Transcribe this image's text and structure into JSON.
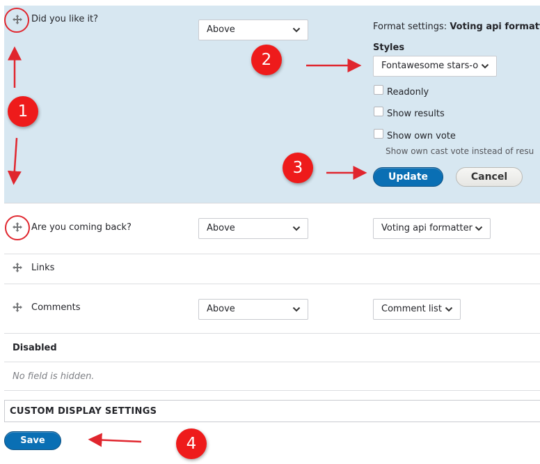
{
  "rows": {
    "did_you_like": {
      "field_label": "Did you like it?",
      "label_select": "Above",
      "format_settings_prefix": "Format settings:",
      "format_settings_name": "Voting api formatt",
      "styles_label": "Styles",
      "styles_select": "Fontawesome stars-o",
      "checkboxes": [
        {
          "label": "Readonly",
          "checked": false
        },
        {
          "label": "Show results",
          "checked": false
        },
        {
          "label": "Show own vote",
          "checked": false
        }
      ],
      "show_own_vote_help": "Show own cast vote instead of resu",
      "update_label": "Update",
      "cancel_label": "Cancel"
    },
    "coming_back": {
      "field_label": "Are you coming back?",
      "label_select": "Above",
      "format_select": "Voting api formatter"
    },
    "links": {
      "field_label": "Links"
    },
    "comments": {
      "field_label": "Comments",
      "label_select": "Above",
      "format_select": "Comment list"
    }
  },
  "disabled": {
    "heading": "Disabled",
    "empty_text": "No field is hidden."
  },
  "custom_display": {
    "title": "CUSTOM DISPLAY SETTINGS"
  },
  "actions": {
    "save_label": "Save"
  },
  "annotations": {
    "markers": [
      "1",
      "2",
      "3",
      "4"
    ],
    "color": "#ee1b1b"
  },
  "icons": {
    "drag": "move-arrows-icon",
    "dropdown": "chevron-down-icon"
  }
}
